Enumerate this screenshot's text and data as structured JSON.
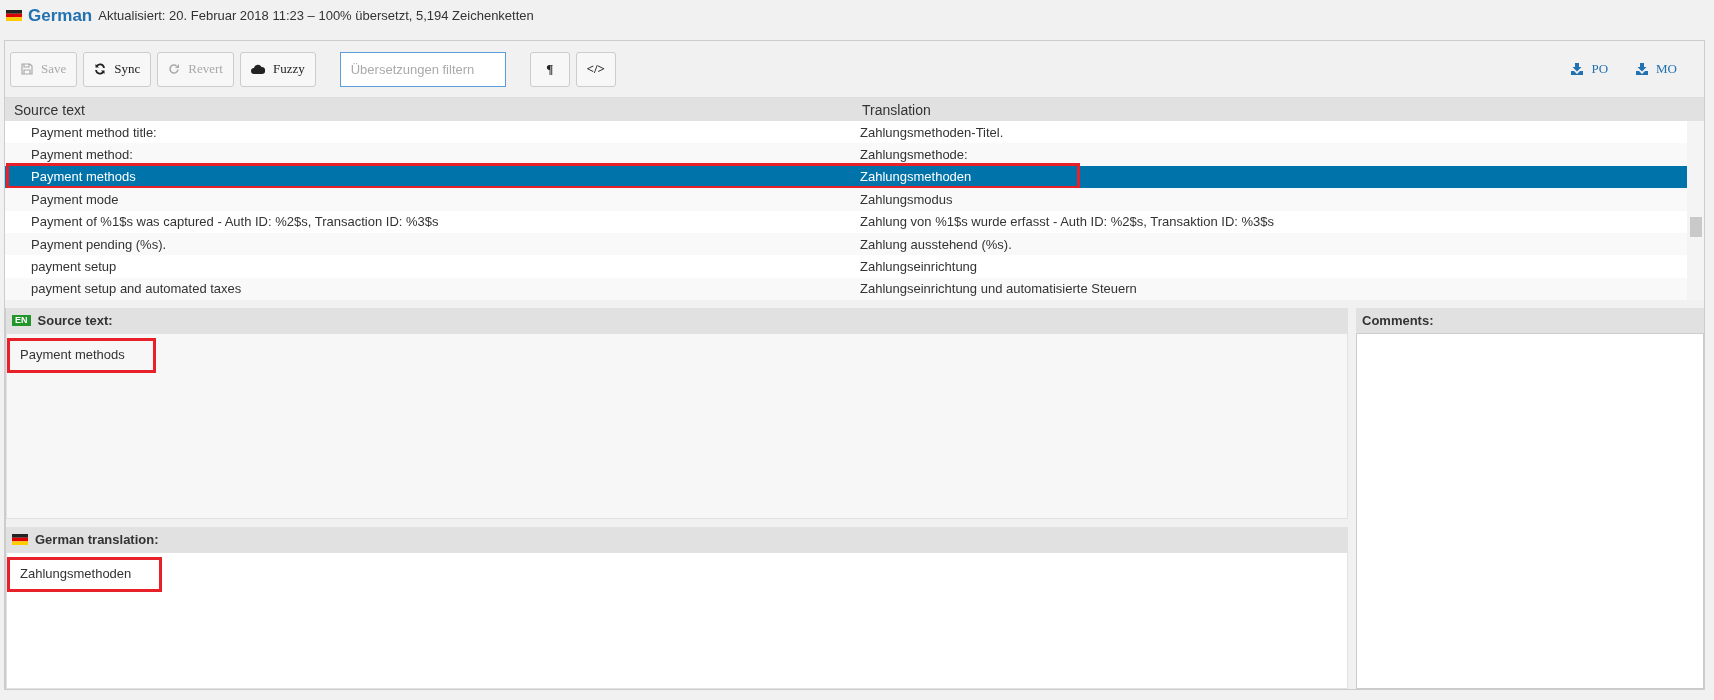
{
  "header": {
    "language": "German",
    "status": "Aktualisiert: 20. Februar 2018 11:23 – 100% übersetzt, 5,194 Zeichenketten"
  },
  "toolbar": {
    "buttons": [
      {
        "kind": "save",
        "label": "Save",
        "disabled": true
      },
      {
        "kind": "sync",
        "label": "Sync",
        "disabled": false
      },
      {
        "kind": "revert",
        "label": "Revert",
        "disabled": true
      },
      {
        "kind": "fuzzy",
        "label": "Fuzzy",
        "disabled": false
      }
    ],
    "filter": {
      "placeholder": "Übersetzungen filtern"
    },
    "toggles": [
      "¶",
      "</>"
    ],
    "downloads": [
      "PO",
      "MO"
    ]
  },
  "table": {
    "columns": [
      "Source text",
      "Translation"
    ],
    "rows": [
      {
        "source": "Payment method title:",
        "translation": "Zahlungsmethoden-Titel.",
        "selected": false,
        "highlighted": false
      },
      {
        "source": "Payment method:",
        "translation": "Zahlungsmethode:",
        "selected": false,
        "highlighted": false
      },
      {
        "source": "Payment methods",
        "translation": "Zahlungsmethoden",
        "selected": true,
        "highlighted": true
      },
      {
        "source": "Payment mode",
        "translation": "Zahlungsmodus",
        "selected": false,
        "highlighted": false
      },
      {
        "source": "Payment of %1$s was captured - Auth ID: %2$s, Transaction ID: %3$s",
        "translation": "Zahlung von %1$s wurde erfasst - Auth ID: %2$s, Transaktion ID: %3$s",
        "selected": false,
        "highlighted": false
      },
      {
        "source": "Payment pending (%s).",
        "translation": "Zahlung ausstehend (%s).",
        "selected": false,
        "highlighted": false
      },
      {
        "source": "payment setup",
        "translation": "Zahlungseinrichtung",
        "selected": false,
        "highlighted": false
      },
      {
        "source": "payment setup and automated taxes",
        "translation": "Zahlungseinrichtung und automatisierte Steuern",
        "selected": false,
        "highlighted": false
      }
    ]
  },
  "source_panel": {
    "badge": "EN",
    "title": "Source text:",
    "text": "Payment methods",
    "highlighted": true
  },
  "translation_panel": {
    "title": "German translation:",
    "text": "Zahlungsmethoden",
    "highlighted": true
  },
  "comments_panel": {
    "title": "Comments:"
  }
}
